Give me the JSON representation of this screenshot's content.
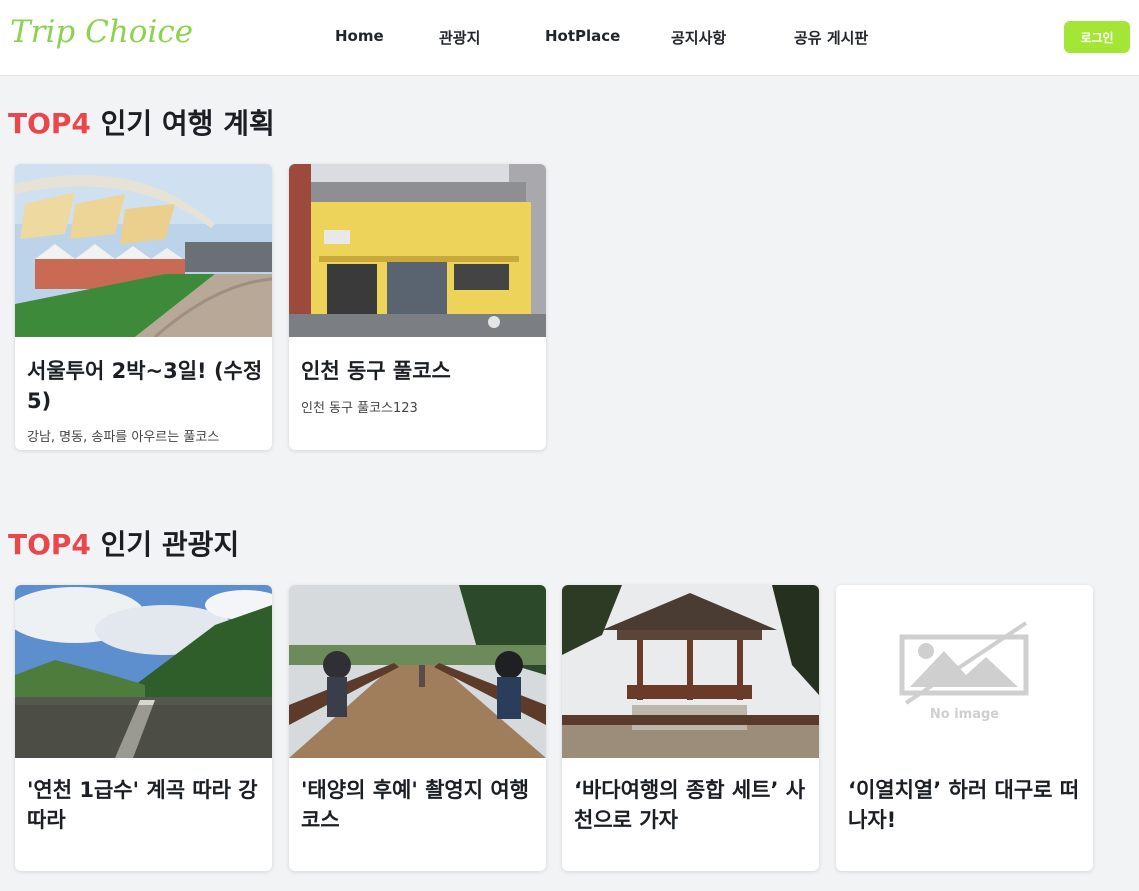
{
  "brand": {
    "logo_text": "Trip Choice",
    "accent_color": "#8bd34c"
  },
  "nav": {
    "items": [
      {
        "label": "Home"
      },
      {
        "label": "관광지"
      },
      {
        "label": "HotPlace"
      },
      {
        "label": "공지사항"
      },
      {
        "label": "공유 게시판"
      }
    ],
    "login_label": "로그인",
    "login_color": "#a3e635"
  },
  "plans": {
    "title_accent": "TOP4",
    "title_rest": " 인기 여행 계획",
    "cards": [
      {
        "title": "서울투어 2박~3일! (수정5)",
        "description": "강남, 명동, 송파를 아우르는 풀코스",
        "image_icon": "festival-tents-photo"
      },
      {
        "title": "인천 동구 풀코스",
        "description": "인천 동구 풀코스123",
        "image_icon": "yellow-building-photo"
      }
    ]
  },
  "attractions": {
    "title_accent": "TOP4",
    "title_rest": " 인기 관광지",
    "cards": [
      {
        "title": "'연천 1급수' 계곡 따라 강따라",
        "image_icon": "valley-stream-photo"
      },
      {
        "title": "'태양의 후예' 촬영지 여행코스",
        "image_icon": "wooden-bridge-photo"
      },
      {
        "title": "‘바다여행의 종합 세트’ 사천으로 가자",
        "image_icon": "pavilion-photo"
      },
      {
        "title": "‘이열치열’ 하러 대구로 떠나자!",
        "image_icon": "no-image-placeholder",
        "placeholder_text": "No image"
      }
    ]
  },
  "colors": {
    "top4_red": "#e8474c",
    "background": "#f2f3f5"
  }
}
